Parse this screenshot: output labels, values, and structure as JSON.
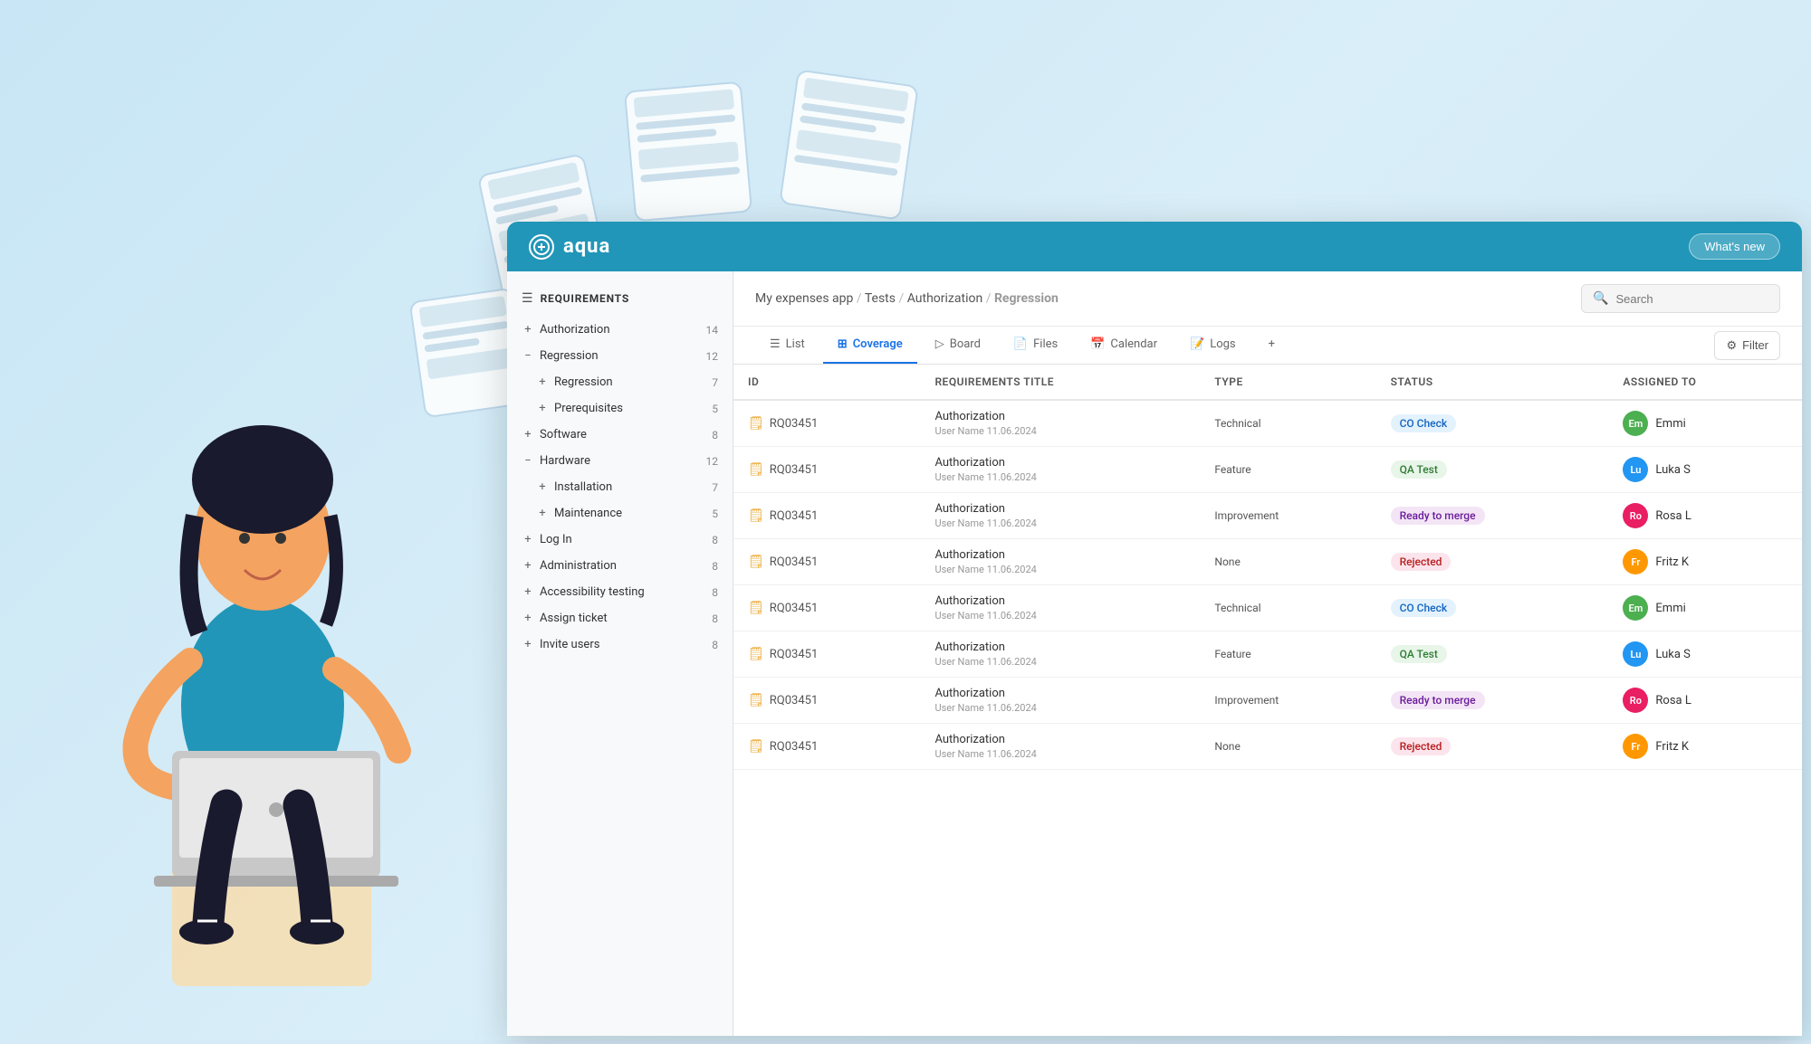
{
  "background": {
    "color": "#cce6f5"
  },
  "nav": {
    "logo": "aqua",
    "whats_new": "What's new"
  },
  "sidebar": {
    "title": "REQUIREMENTS",
    "items": [
      {
        "id": "authorization",
        "label": "Authorization",
        "count": "14",
        "expanded": false,
        "indent": 0,
        "icon": "+"
      },
      {
        "id": "regression",
        "label": "Regression",
        "count": "12",
        "expanded": true,
        "indent": 0,
        "icon": "−"
      },
      {
        "id": "regression-sub",
        "label": "Regression",
        "count": "7",
        "expanded": false,
        "indent": 1,
        "icon": "+"
      },
      {
        "id": "prerequisites",
        "label": "Prerequisites",
        "count": "5",
        "expanded": false,
        "indent": 1,
        "icon": "+"
      },
      {
        "id": "software",
        "label": "Software",
        "count": "8",
        "expanded": false,
        "indent": 0,
        "icon": "+"
      },
      {
        "id": "hardware",
        "label": "Hardware",
        "count": "12",
        "expanded": true,
        "indent": 0,
        "icon": "−"
      },
      {
        "id": "installation",
        "label": "Installation",
        "count": "7",
        "expanded": false,
        "indent": 1,
        "icon": "+"
      },
      {
        "id": "maintenance",
        "label": "Maintenance",
        "count": "5",
        "expanded": false,
        "indent": 1,
        "icon": "+"
      },
      {
        "id": "login",
        "label": "Log In",
        "count": "8",
        "expanded": false,
        "indent": 0,
        "icon": "+"
      },
      {
        "id": "administration",
        "label": "Administration",
        "count": "8",
        "expanded": false,
        "indent": 0,
        "icon": "+"
      },
      {
        "id": "accessibility",
        "label": "Accessibility testing",
        "count": "8",
        "expanded": false,
        "indent": 0,
        "icon": "+"
      },
      {
        "id": "assign-ticket",
        "label": "Assign ticket",
        "count": "8",
        "expanded": false,
        "indent": 0,
        "icon": "+"
      },
      {
        "id": "invite-users",
        "label": "Invite users",
        "count": "8",
        "expanded": false,
        "indent": 0,
        "icon": "+"
      }
    ]
  },
  "breadcrumb": {
    "parts": [
      "My expenses app",
      "Tests",
      "Authorization",
      "Regression"
    ]
  },
  "search": {
    "placeholder": "Search"
  },
  "tabs": [
    {
      "id": "list",
      "label": "List",
      "icon": "☰",
      "active": false
    },
    {
      "id": "coverage",
      "label": "Coverage",
      "icon": "⊞",
      "active": true
    },
    {
      "id": "board",
      "label": "Board",
      "icon": "▷",
      "active": false
    },
    {
      "id": "files",
      "label": "Files",
      "icon": "📄",
      "active": false
    },
    {
      "id": "calendar",
      "label": "Calendar",
      "icon": "📅",
      "active": false
    },
    {
      "id": "logs",
      "label": "Logs",
      "icon": "📝",
      "active": false
    }
  ],
  "filter_label": "Filter",
  "table": {
    "columns": [
      "ID",
      "Requirements title",
      "Type",
      "Status",
      "Assigned to"
    ],
    "rows": [
      {
        "id": "RQ03451",
        "title": "Authorization",
        "subtitle": "User Name   11.06.2024",
        "type": "Technical",
        "status": "CO Check",
        "status_class": "status-co-check",
        "assignee": "Emmi",
        "avatar_class": "avatar-em",
        "avatar_initials": "Em"
      },
      {
        "id": "RQ03451",
        "title": "Authorization",
        "subtitle": "User Name   11.06.2024",
        "type": "Feature",
        "status": "QA Test",
        "status_class": "status-qa-test",
        "assignee": "Luka S",
        "avatar_class": "avatar-lu",
        "avatar_initials": "Lu"
      },
      {
        "id": "RQ03451",
        "title": "Authorization",
        "subtitle": "User Name   11.06.2024",
        "type": "Improvement",
        "status": "Ready to merge",
        "status_class": "status-ready-merge",
        "assignee": "Rosa L",
        "avatar_class": "avatar-ro",
        "avatar_initials": "Ro"
      },
      {
        "id": "RQ03451",
        "title": "Authorization",
        "subtitle": "User Name   11.06.2024",
        "type": "None",
        "status": "Rejected",
        "status_class": "status-rejected",
        "assignee": "Fritz K",
        "avatar_class": "avatar-fr",
        "avatar_initials": "Fr"
      },
      {
        "id": "RQ03451",
        "title": "Authorization",
        "subtitle": "User Name   11.06.2024",
        "type": "Technical",
        "status": "CO Check",
        "status_class": "status-co-check",
        "assignee": "Emmi",
        "avatar_class": "avatar-em",
        "avatar_initials": "Em"
      },
      {
        "id": "RQ03451",
        "title": "Authorization",
        "subtitle": "User Name   11.06.2024",
        "type": "Feature",
        "status": "QA Test",
        "status_class": "status-qa-test",
        "assignee": "Luka S",
        "avatar_class": "avatar-lu",
        "avatar_initials": "Lu"
      },
      {
        "id": "RQ03451",
        "title": "Authorization",
        "subtitle": "User Name   11.06.2024",
        "type": "Improvement",
        "status": "Ready to merge",
        "status_class": "status-ready-merge",
        "assignee": "Rosa L",
        "avatar_class": "avatar-ro",
        "avatar_initials": "Ro"
      },
      {
        "id": "RQ03451",
        "title": "Authorization",
        "subtitle": "User Name   11.06.2024",
        "type": "None",
        "status": "Rejected",
        "status_class": "status-rejected",
        "assignee": "Fritz K",
        "avatar_class": "avatar-fr",
        "avatar_initials": "Fr"
      }
    ]
  }
}
